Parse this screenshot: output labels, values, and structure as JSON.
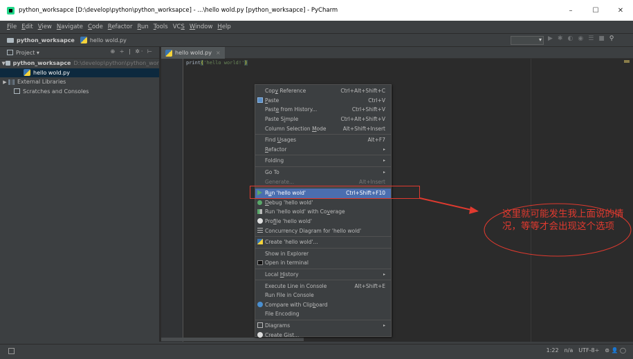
{
  "window": {
    "title": "python_worksapce [D:\\develop\\python\\python_worksapce] - ...\\hello wold.py [python_worksapce] - PyCharm",
    "controls": {
      "minimize": "–",
      "maximize": "☐",
      "close": "✕"
    }
  },
  "menubar": {
    "items": [
      {
        "u": "F",
        "rest": "ile"
      },
      {
        "u": "E",
        "rest": "dit"
      },
      {
        "u": "V",
        "rest": "iew"
      },
      {
        "u": "N",
        "rest": "avigate"
      },
      {
        "u": "C",
        "rest": "ode"
      },
      {
        "u": "R",
        "rest": "efactor"
      },
      {
        "u": "R",
        "rest": "un"
      },
      {
        "u": "T",
        "rest": "ools"
      },
      {
        "pre": "VC",
        "u": "S",
        "rest": ""
      },
      {
        "u": "W",
        "rest": "indow"
      },
      {
        "u": "H",
        "rest": "elp"
      }
    ]
  },
  "navbar": {
    "project": "python_worksapce",
    "file": "hello wold.py"
  },
  "project_pane": {
    "header": "Project",
    "header_dropdown": "▾",
    "header_icons": "⊕ ÷ | ✲· ⊢",
    "root_name": "python_worksapce",
    "root_path": "D:\\develop\\python\\python_wor",
    "file": "hello wold.py",
    "external_libraries": "External Libraries",
    "scratches": "Scratches and Consoles"
  },
  "editor": {
    "tab": "hello wold.py",
    "tab_close": "×",
    "code_fn": "print",
    "code_open": "(",
    "code_str": "'hello world!'",
    "code_close": ")"
  },
  "context_menu": {
    "items": [
      {
        "pre": "Cop",
        "u": "y",
        "post": " Reference",
        "shortcut": "Ctrl+Alt+Shift+C"
      },
      {
        "pre": "",
        "u": "P",
        "post": "aste",
        "shortcut": "Ctrl+V"
      },
      {
        "pre": "Past",
        "u": "e",
        "post": " from History...",
        "shortcut": "Ctrl+Shift+V"
      },
      {
        "pre": "Paste S",
        "u": "i",
        "post": "mple",
        "shortcut": "Ctrl+Alt+Shift+V"
      },
      {
        "pre": "Column Selection ",
        "u": "M",
        "post": "ode",
        "shortcut": "Alt+Shift+Insert"
      },
      {
        "pre": "Find ",
        "u": "U",
        "post": "sages",
        "shortcut": "Alt+F7"
      },
      {
        "pre": "",
        "u": "R",
        "post": "efactor"
      },
      {
        "pre": "Folding",
        "u": "",
        "post": ""
      },
      {
        "pre": "Go To",
        "u": "",
        "post": ""
      },
      {
        "pre": "Generate...",
        "u": "",
        "post": "",
        "shortcut": "Alt+Insert"
      },
      {
        "pre": "R",
        "u": "u",
        "post": "n 'hello wold'",
        "shortcut": "Ctrl+Shift+F10"
      },
      {
        "pre": "",
        "u": "D",
        "post": "ebug 'hello wold'"
      },
      {
        "pre": "Run 'hello wold' with Co",
        "u": "v",
        "post": "erage"
      },
      {
        "pre": "Pro",
        "u": "f",
        "post": "ile 'hello wold'"
      },
      {
        "pre": "Concurrency Diagram for 'hello wold'",
        "u": "",
        "post": ""
      },
      {
        "pre": "Create 'hello wold'...",
        "u": "",
        "post": ""
      },
      {
        "pre": "Show in Explorer",
        "u": "",
        "post": ""
      },
      {
        "pre": "Open in terminal",
        "u": "",
        "post": ""
      },
      {
        "pre": "Local ",
        "u": "H",
        "post": "istory"
      },
      {
        "pre": "Execute Line in Console",
        "u": "",
        "post": "",
        "shortcut": "Alt+Shift+E"
      },
      {
        "pre": "Run File in Console",
        "u": "",
        "post": ""
      },
      {
        "pre": "Compare with Clip",
        "u": "b",
        "post": "oard"
      },
      {
        "pre": "File Encoding",
        "u": "",
        "post": ""
      },
      {
        "pre": "Diagrams",
        "u": "",
        "post": ""
      },
      {
        "pre": "Create Gist...",
        "u": "",
        "post": ""
      }
    ],
    "submenu_arrow": "▸"
  },
  "annotation": {
    "text": "这里就可能发生我上面说的情况，等等才会出现这个选项",
    "color": "#e03a2f"
  },
  "statusbar": {
    "position": "1:22",
    "separator": "n/a",
    "encoding": "UTF-8",
    "encoding_chev": "÷",
    "icons": "⊚ 👤 ◯"
  },
  "colors": {
    "bg": "#3c3f41",
    "editor_bg": "#2b2b2b",
    "selection": "#4b6eaf",
    "string": "#6a8759"
  }
}
